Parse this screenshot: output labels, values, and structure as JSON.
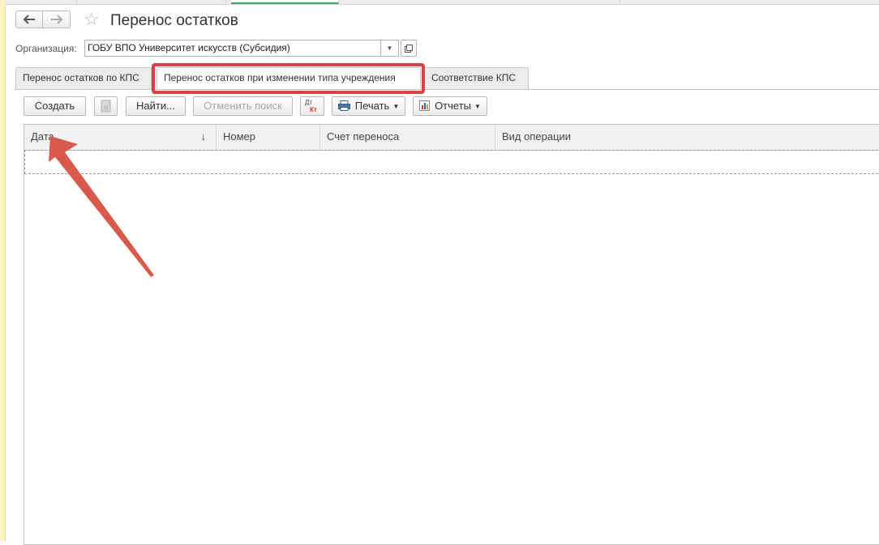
{
  "window": {
    "title": "Перенос остатков"
  },
  "nav": {
    "back": "back-arrow-icon",
    "forward": "forward-arrow-icon",
    "favorite": "star-icon"
  },
  "filter": {
    "org_label": "Организация:",
    "org_value": "ГОБУ ВПО Университет искусств (Субсидия)"
  },
  "tabs": [
    {
      "label": "Перенос остатков по КПС"
    },
    {
      "label": "Перенос остатков при изменении типа учреждения"
    },
    {
      "label": "Соответствие КПС"
    }
  ],
  "toolbar": {
    "create_label": "Создать",
    "find_label": "Найти...",
    "cancel_search_label": "Отменить поиск",
    "dt_label": "Дт",
    "kt_label": "Кт",
    "print_label": "Печать",
    "reports_label": "Отчеты"
  },
  "table": {
    "columns": [
      "Дата",
      "Номер",
      "Счет переноса",
      "Вид операции"
    ],
    "sort_indicator": "↓",
    "rows": []
  },
  "colors": {
    "highlight": "#d0444a",
    "arrow": "#d85a4e",
    "accent_tab": "#4aa164"
  }
}
